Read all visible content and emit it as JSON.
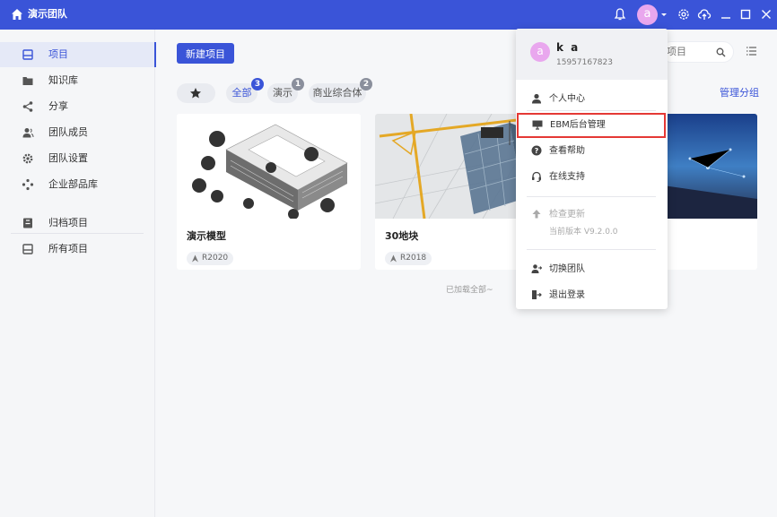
{
  "titlebar": {
    "team_name": "演示团队",
    "avatar_letter": "a",
    "icons": [
      "home-icon",
      "bell-icon",
      "settings-icon",
      "cloud-upload-icon",
      "minimize-icon",
      "maximize-icon",
      "close-icon"
    ]
  },
  "sidebar": {
    "items": [
      {
        "label": "项目",
        "icon": "project-icon",
        "active": true
      },
      {
        "label": "知识库",
        "icon": "folder-icon"
      },
      {
        "label": "分享",
        "icon": "share-icon"
      },
      {
        "label": "团队成员",
        "icon": "members-icon"
      },
      {
        "label": "团队设置",
        "icon": "gear-icon"
      },
      {
        "label": "企业部品库",
        "icon": "components-icon"
      },
      {
        "label": "归档项目",
        "icon": "archive-icon"
      },
      {
        "label": "所有项目",
        "icon": "all-projects-icon"
      }
    ]
  },
  "main": {
    "new_project_label": "新建项目",
    "search_placeholder": "项目",
    "manage_groups_label": "管理分组",
    "filters": [
      {
        "label": "全部",
        "count": "3",
        "badge_color": "#3a54d8"
      },
      {
        "label": "演示",
        "count": "1",
        "badge_color": "#8a8f9c"
      },
      {
        "label": "商业综合体",
        "count": "2",
        "badge_color": "#8a8f9c"
      }
    ],
    "cards": [
      {
        "title": "演示模型",
        "version": "R2020"
      },
      {
        "title": "30地块",
        "version": "R2018"
      },
      {
        "title": "",
        "version": ""
      }
    ],
    "loaded_all": "已加载全部~"
  },
  "dropdown": {
    "user_name": "k a",
    "phone": "15957167823",
    "avatar_letter": "a",
    "items": {
      "profile": "个人中心",
      "ebm_admin": "EBM后台管理",
      "help": "查看帮助",
      "support": "在线支持",
      "check_update": "检查更新",
      "current_version": "当前版本 V9.2.0.0",
      "switch_team": "切换团队",
      "logout": "退出登录"
    }
  },
  "colors": {
    "primary": "#3a54d8",
    "avatar": "#e9a7ee",
    "highlight_border": "#e53935"
  }
}
